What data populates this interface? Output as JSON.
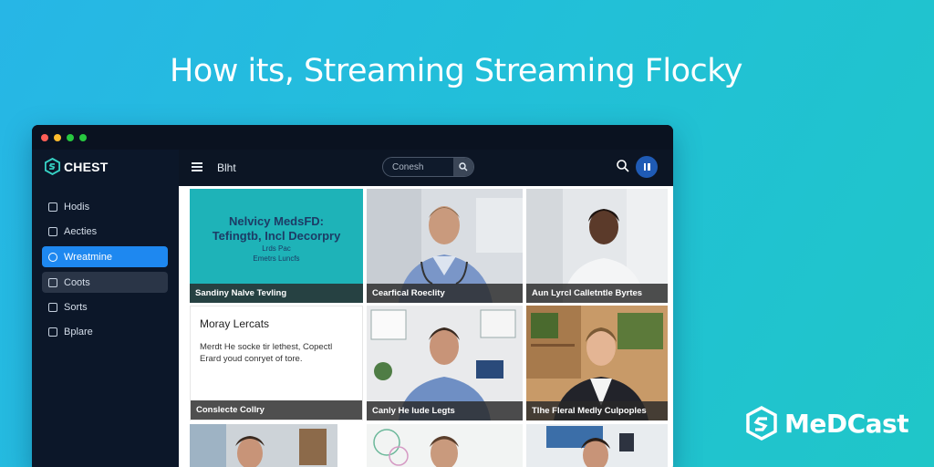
{
  "headline": "How its, Streaming Streaming Flocky",
  "brand": {
    "name": "MeDCast"
  },
  "window": {
    "traffic_lights": [
      "#ff5f57",
      "#febc2e",
      "#28c840",
      "#28c840"
    ],
    "sidebar": {
      "logo": "CHEST",
      "items": [
        {
          "label": "Hodis",
          "state": "normal"
        },
        {
          "label": "Aecties",
          "state": "normal"
        },
        {
          "label": "Wreatmine",
          "state": "active"
        },
        {
          "label": "Coots",
          "state": "hover"
        },
        {
          "label": "Sorts",
          "state": "normal"
        },
        {
          "label": "Bplare",
          "state": "normal"
        }
      ]
    },
    "topbar": {
      "page_label": "Blht",
      "search_placeholder": "Conesh"
    },
    "cards": [
      {
        "type": "promo",
        "title": "Nelvicy MedsFD:\nTefingtb, Incl Decorpry",
        "subtitle": "Lrds Pac\nEmetrs Luncfs",
        "caption": "Sandiny Nalve Tevling"
      },
      {
        "type": "video",
        "caption": "Cearfical Roeclity"
      },
      {
        "type": "video",
        "caption": "Aun Lyrcl Calletntle Byrtes"
      },
      {
        "type": "text",
        "title": "Moray Lercats",
        "body": "Merdt He socke tir lethest, Copectl Erard youd conryet of tore.",
        "caption": "Conslecte Collry"
      },
      {
        "type": "video",
        "caption": "Canly He lude Legts"
      },
      {
        "type": "video",
        "caption": "Tlhe Fleral Medly Culpoples"
      },
      {
        "type": "video",
        "caption": ""
      },
      {
        "type": "video",
        "caption": ""
      },
      {
        "type": "video",
        "caption": ""
      }
    ],
    "colors": {
      "accent": "#1e88f0",
      "sidebar": "#0c1729",
      "window": "#0c1524"
    }
  }
}
